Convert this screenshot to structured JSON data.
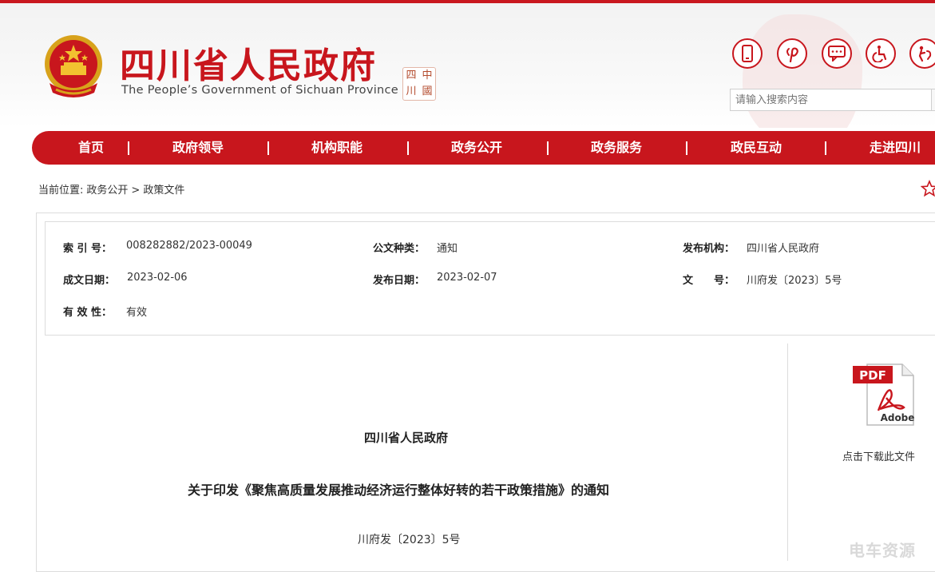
{
  "header": {
    "title": "四川省人民政府",
    "subtitle": "The People’s Government of Sichuan Province",
    "seal_chars": [
      "中",
      "四",
      "川",
      "國"
    ],
    "search_placeholder": "请输入搜索内容",
    "icons": [
      "mobile-icon",
      "pinterest-icon",
      "chat-icon",
      "accessibility-icon",
      "elderly-care-icon"
    ],
    "accent_color": "#c8161d"
  },
  "nav": {
    "items": [
      "首页",
      "政府领导",
      "机构职能",
      "政务公开",
      "政务服务",
      "政民互动",
      "走进四川"
    ],
    "separator": "|"
  },
  "breadcrumb": {
    "prefix": "当前位置:",
    "path": [
      "政务公开",
      "政策文件"
    ],
    "separator": ">"
  },
  "meta": {
    "index_label": "索 引 号：",
    "index_value": "008282882/2023-00049",
    "type_label": "公文种类：",
    "type_value": "通知",
    "publisher_label": "发布机构：",
    "publisher_value": "四川省人民政府",
    "created_label": "成文日期：",
    "created_value": "2023-02-06",
    "published_label": "发布日期：",
    "published_value": "2023-02-07",
    "docno_label": "文　　号：",
    "docno_value": "川府发〔2023〕5号",
    "validity_label": "有 效 性：",
    "validity_value": "有效"
  },
  "sidebar": {
    "pdf_badge": "PDF",
    "pdf_brand": "Adobe",
    "download_label": "点击下载此文件"
  },
  "document": {
    "issuer": "四川省人民政府",
    "title": "关于印发《聚焦高质量发展推动经济运行整体好转的若干政策措施》的通知",
    "number": "川府发〔2023〕5号"
  },
  "watermark": "电车资源"
}
